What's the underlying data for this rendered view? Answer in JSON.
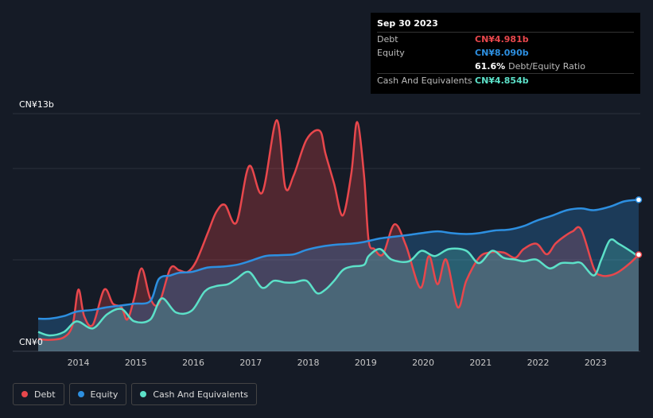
{
  "tooltip": {
    "date": "Sep 30 2023",
    "rows": [
      {
        "label": "Debt",
        "value": "CN¥4.981b",
        "color": "#e8474c"
      },
      {
        "label": "Equity",
        "value": "CN¥8.090b",
        "color": "#2d8fe0"
      },
      {
        "label": "",
        "value": "61.6%",
        "sub": "Debt/Equity Ratio",
        "color": "#ffffff"
      },
      {
        "label": "Cash And Equivalents",
        "value": "CN¥4.854b",
        "color": "#5ce0c8"
      }
    ]
  },
  "legend": [
    {
      "label": "Debt",
      "color": "#e8474c"
    },
    {
      "label": "Equity",
      "color": "#2d8fe0"
    },
    {
      "label": "Cash And Equivalents",
      "color": "#5ce0c8"
    }
  ],
  "chart_data": {
    "type": "area",
    "y_top_label": "CN¥13b",
    "y_bottom_label": "CN¥0",
    "ylim": [
      0,
      13
    ],
    "xlim": [
      2013.3,
      2023.75
    ],
    "x_ticks": [
      "2014",
      "2015",
      "2016",
      "2017",
      "2018",
      "2019",
      "2020",
      "2021",
      "2022",
      "2023"
    ],
    "series": [
      {
        "name": "Debt",
        "color": "#e8474c",
        "x": [
          2013.3,
          2013.5,
          2013.75,
          2013.9,
          2014.0,
          2014.1,
          2014.25,
          2014.45,
          2014.6,
          2014.75,
          2014.85,
          2014.97,
          2015.1,
          2015.25,
          2015.4,
          2015.6,
          2015.75,
          2015.9,
          2016.05,
          2016.25,
          2016.4,
          2016.55,
          2016.75,
          2016.97,
          2017.2,
          2017.45,
          2017.6,
          2017.75,
          2017.97,
          2018.2,
          2018.3,
          2018.45,
          2018.6,
          2018.75,
          2018.85,
          2018.97,
          2019.05,
          2019.15,
          2019.3,
          2019.5,
          2019.7,
          2019.95,
          2020.1,
          2020.25,
          2020.4,
          2020.6,
          2020.75,
          2020.97,
          2021.15,
          2021.4,
          2021.6,
          2021.75,
          2021.97,
          2022.15,
          2022.3,
          2022.45,
          2022.6,
          2022.75,
          2022.97,
          2023.1,
          2023.25,
          2023.4,
          2023.6,
          2023.75
        ],
        "values": [
          0.2,
          0.15,
          0.3,
          1.0,
          3.0,
          1.5,
          1.0,
          3.0,
          2.2,
          2.0,
          1.3,
          2.5,
          4.2,
          2.5,
          2.2,
          4.2,
          4.1,
          4.0,
          4.6,
          6.2,
          7.4,
          7.8,
          6.8,
          10.0,
          8.5,
          12.6,
          8.8,
          9.5,
          11.5,
          12.0,
          10.7,
          9.0,
          7.2,
          9.6,
          12.5,
          9.5,
          5.8,
          5.3,
          5.0,
          6.7,
          5.5,
          3.1,
          4.9,
          3.3,
          4.7,
          2.0,
          3.5,
          4.8,
          5.1,
          5.1,
          4.8,
          5.3,
          5.6,
          5.0,
          5.6,
          6.0,
          6.3,
          6.4,
          4.2,
          3.8,
          3.8,
          4.0,
          4.5,
          4.98
        ]
      },
      {
        "name": "Equity",
        "color": "#2d8fe0",
        "x": [
          2013.3,
          2013.5,
          2013.75,
          2013.97,
          2014.25,
          2014.5,
          2014.75,
          2014.97,
          2015.25,
          2015.4,
          2015.6,
          2015.75,
          2015.97,
          2016.25,
          2016.5,
          2016.75,
          2016.97,
          2017.25,
          2017.5,
          2017.75,
          2017.97,
          2018.25,
          2018.5,
          2018.75,
          2018.97,
          2019.25,
          2019.5,
          2019.75,
          2019.97,
          2020.25,
          2020.5,
          2020.75,
          2020.97,
          2021.25,
          2021.5,
          2021.75,
          2021.97,
          2022.25,
          2022.5,
          2022.75,
          2022.97,
          2023.25,
          2023.5,
          2023.75
        ],
        "values": [
          1.35,
          1.35,
          1.5,
          1.75,
          1.85,
          2.0,
          2.1,
          2.2,
          2.35,
          3.6,
          3.8,
          3.95,
          4.0,
          4.25,
          4.3,
          4.4,
          4.6,
          4.9,
          4.95,
          5.0,
          5.25,
          5.45,
          5.55,
          5.6,
          5.7,
          5.9,
          6.0,
          6.1,
          6.2,
          6.3,
          6.2,
          6.15,
          6.2,
          6.35,
          6.4,
          6.6,
          6.9,
          7.2,
          7.5,
          7.6,
          7.5,
          7.7,
          8.0,
          8.09
        ]
      },
      {
        "name": "Cash And Equivalents",
        "color": "#5ce0c8",
        "x": [
          2013.3,
          2013.5,
          2013.75,
          2013.97,
          2014.25,
          2014.5,
          2014.75,
          2014.97,
          2015.25,
          2015.45,
          2015.7,
          2015.97,
          2016.2,
          2016.4,
          2016.6,
          2016.75,
          2016.97,
          2017.2,
          2017.4,
          2017.6,
          2017.75,
          2017.97,
          2018.15,
          2018.3,
          2018.45,
          2018.6,
          2018.75,
          2018.97,
          2019.05,
          2019.25,
          2019.45,
          2019.75,
          2019.97,
          2020.2,
          2020.45,
          2020.75,
          2020.97,
          2021.2,
          2021.4,
          2021.6,
          2021.75,
          2021.97,
          2022.2,
          2022.4,
          2022.6,
          2022.75,
          2022.97,
          2023.1,
          2023.25,
          2023.4,
          2023.6,
          2023.75
        ],
        "values": [
          0.6,
          0.4,
          0.6,
          1.2,
          0.8,
          1.6,
          1.9,
          1.2,
          1.3,
          2.5,
          1.7,
          1.8,
          2.9,
          3.2,
          3.3,
          3.6,
          4.0,
          3.1,
          3.5,
          3.4,
          3.4,
          3.5,
          2.8,
          3.0,
          3.5,
          4.1,
          4.3,
          4.4,
          4.9,
          5.3,
          4.7,
          4.6,
          5.2,
          4.9,
          5.3,
          5.2,
          4.5,
          5.2,
          4.8,
          4.7,
          4.6,
          4.7,
          4.2,
          4.5,
          4.5,
          4.5,
          3.8,
          4.7,
          5.8,
          5.6,
          5.2,
          4.85
        ]
      }
    ]
  }
}
